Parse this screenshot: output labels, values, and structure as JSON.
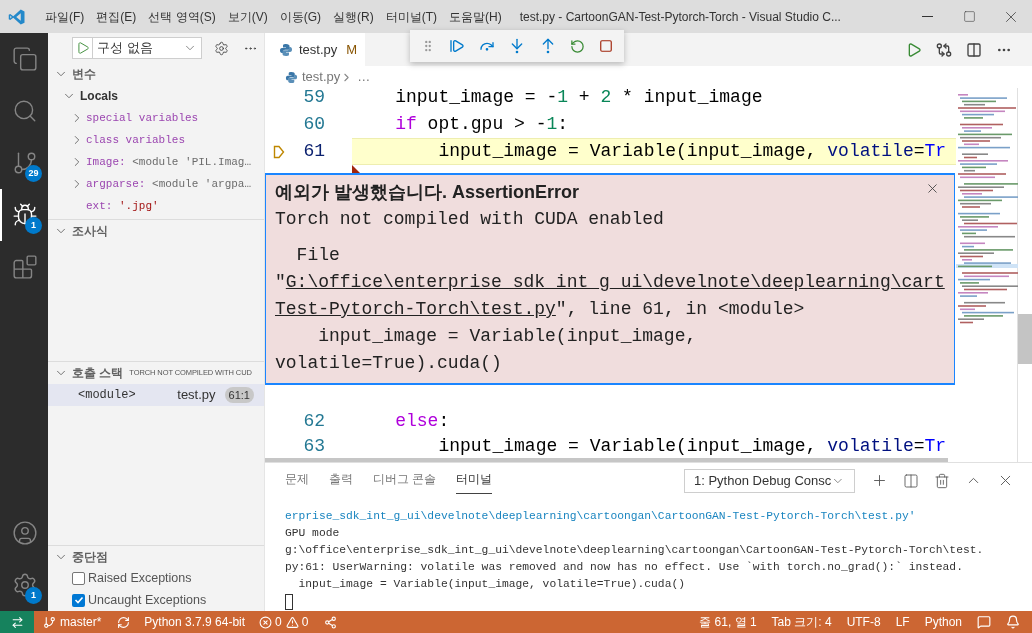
{
  "window": {
    "title": "test.py - CartoonGAN-Test-Pytorch-Torch - Visual Studio C..."
  },
  "menu": [
    "파일(F)",
    "편집(E)",
    "선택 영역(S)",
    "보기(V)",
    "이동(G)",
    "실행(R)",
    "터미널(T)",
    "도움말(H)"
  ],
  "activity_bar": {
    "top": [
      {
        "kind": "files",
        "selected": false
      },
      {
        "kind": "search",
        "selected": false
      },
      {
        "kind": "source-control",
        "selected": false,
        "badge": "29"
      },
      {
        "kind": "debug",
        "selected": true,
        "badge": "1"
      },
      {
        "kind": "extensions",
        "selected": false
      }
    ],
    "bottom": [
      {
        "kind": "accounts",
        "selected": false
      },
      {
        "kind": "settings",
        "selected": false,
        "badge": "1"
      }
    ]
  },
  "sidebar": {
    "run_config": "구성 없음",
    "variables": {
      "title": "변수",
      "expanded": true,
      "scopes": [
        {
          "label": "Locals",
          "expanded": true,
          "children": [
            {
              "kind": "group",
              "name": "special variables",
              "expandable": true
            },
            {
              "kind": "group",
              "name": "class variables",
              "expandable": true
            },
            {
              "kind": "object",
              "name": "Image:",
              "value": "<module 'PIL.Imag…",
              "expandable": true
            },
            {
              "kind": "object",
              "name": "argparse:",
              "value": "<module 'argpa…",
              "expandable": true
            },
            {
              "kind": "string",
              "name": "ext:",
              "value": "'.jpg'",
              "expandable": false
            }
          ]
        }
      ]
    },
    "watch": {
      "title": "조사식",
      "expanded": true
    },
    "call_stack": {
      "title": "호출 스택",
      "expanded": true,
      "status": "TORCH NOT COMPILED WITH CUD",
      "frames": [
        {
          "name": "<module>",
          "file": "test.py",
          "position": "61:1",
          "selected": true
        }
      ]
    },
    "breakpoints": {
      "title": "중단점",
      "expanded": true,
      "items": [
        {
          "label": "Raised Exceptions",
          "checked": false
        },
        {
          "label": "Uncaught Exceptions",
          "checked": true
        }
      ]
    }
  },
  "editor": {
    "tabs": [
      {
        "label": "test.py",
        "badge": "M",
        "selected": true
      }
    ],
    "breadcrumb": [
      "test.py",
      "…"
    ],
    "lines_before": [
      {
        "number": "59",
        "current": false,
        "tokens": [
          {
            "kind": "plain",
            "text": "    input_image = "
          },
          {
            "kind": "plain",
            "text": "-"
          },
          {
            "kind": "number",
            "text": "1"
          },
          {
            "kind": "plain",
            "text": " + "
          },
          {
            "kind": "number",
            "text": "2"
          },
          {
            "kind": "plain",
            "text": " * input_image"
          }
        ]
      },
      {
        "number": "60",
        "current": false,
        "tokens": [
          {
            "kind": "keyword",
            "text": "    if"
          },
          {
            "kind": "plain",
            "text": " opt.gpu > -"
          },
          {
            "kind": "number",
            "text": "1"
          },
          {
            "kind": "plain",
            "text": ":"
          }
        ]
      },
      {
        "number": "61",
        "current": true,
        "tokens": [
          {
            "kind": "plain",
            "text": "        input_image = Variable(input_image, "
          },
          {
            "kind": "param",
            "text": "volatile"
          },
          {
            "kind": "plain",
            "text": "="
          },
          {
            "kind": "constant",
            "text": "Tr"
          }
        ]
      }
    ],
    "exception": {
      "title": "예외가 발생했습니다. AssertionError",
      "message": "Torch not compiled with CUDA enabled",
      "traceback": [
        [
          {
            "text": "  File",
            "link": false
          }
        ],
        [
          {
            "text": "\"",
            "link": false
          },
          {
            "text": "G:\\office\\enterprise_sdk_int_g_ui\\develnote\\deeplearning\\cart",
            "link": true
          }
        ],
        [
          {
            "text": "Test-Pytorch-Torch\\test.py",
            "link": true
          },
          {
            "text": "\", line 61, in <module>",
            "link": false
          }
        ],
        [
          {
            "text": "    input_image = Variable(input_image,",
            "link": false
          }
        ],
        [
          {
            "text": "volatile=True).cuda()",
            "link": false
          }
        ]
      ]
    },
    "lines_after": [
      {
        "number": "62",
        "current": false,
        "tokens": [
          {
            "kind": "keyword",
            "text": "    else"
          },
          {
            "kind": "plain",
            "text": ":"
          }
        ]
      },
      {
        "number": "63",
        "current": false,
        "tokens": [
          {
            "kind": "plain",
            "text": "        input_image = Variable(input_image, "
          },
          {
            "kind": "param",
            "text": "volatile"
          },
          {
            "kind": "plain",
            "text": "="
          },
          {
            "kind": "constant",
            "text": "Tr"
          }
        ]
      }
    ]
  },
  "panel": {
    "tabs": [
      {
        "label": "문제",
        "selected": false
      },
      {
        "label": "출력",
        "selected": false
      },
      {
        "label": "디버그 콘솔",
        "selected": false
      },
      {
        "label": "터미널",
        "selected": true
      }
    ],
    "terminal_select": "1: Python Debug Consc",
    "terminal": [
      {
        "kind": "command",
        "text": "erprise_sdk_int_g_ui\\develnote\\deeplearning\\cartoongan\\CartoonGAN-Test-Pytorch-Torch\\test.py'"
      },
      {
        "kind": "output",
        "text": "GPU mode"
      },
      {
        "kind": "output",
        "text": "g:\\office\\enterprise_sdk_int_g_ui\\develnote\\deeplearning\\cartoongan\\CartoonGAN-Test-Pytorch-Torch\\test."
      },
      {
        "kind": "output",
        "text": "py:61: UserWarning: volatile was removed and now has no effect. Use `with torch.no_grad():` instead."
      },
      {
        "kind": "output",
        "text": "  input_image = Variable(input_image, volatile=True).cuda()"
      }
    ]
  },
  "status_bar": {
    "branch": "master*",
    "interpreter": "Python 3.7.9 64-bit",
    "errors": "0",
    "warnings": "0",
    "position": "줄 61, 열 1",
    "tab_size": "Tab 크기: 4",
    "encoding": "UTF-8",
    "eol": "LF",
    "language": "Python"
  }
}
